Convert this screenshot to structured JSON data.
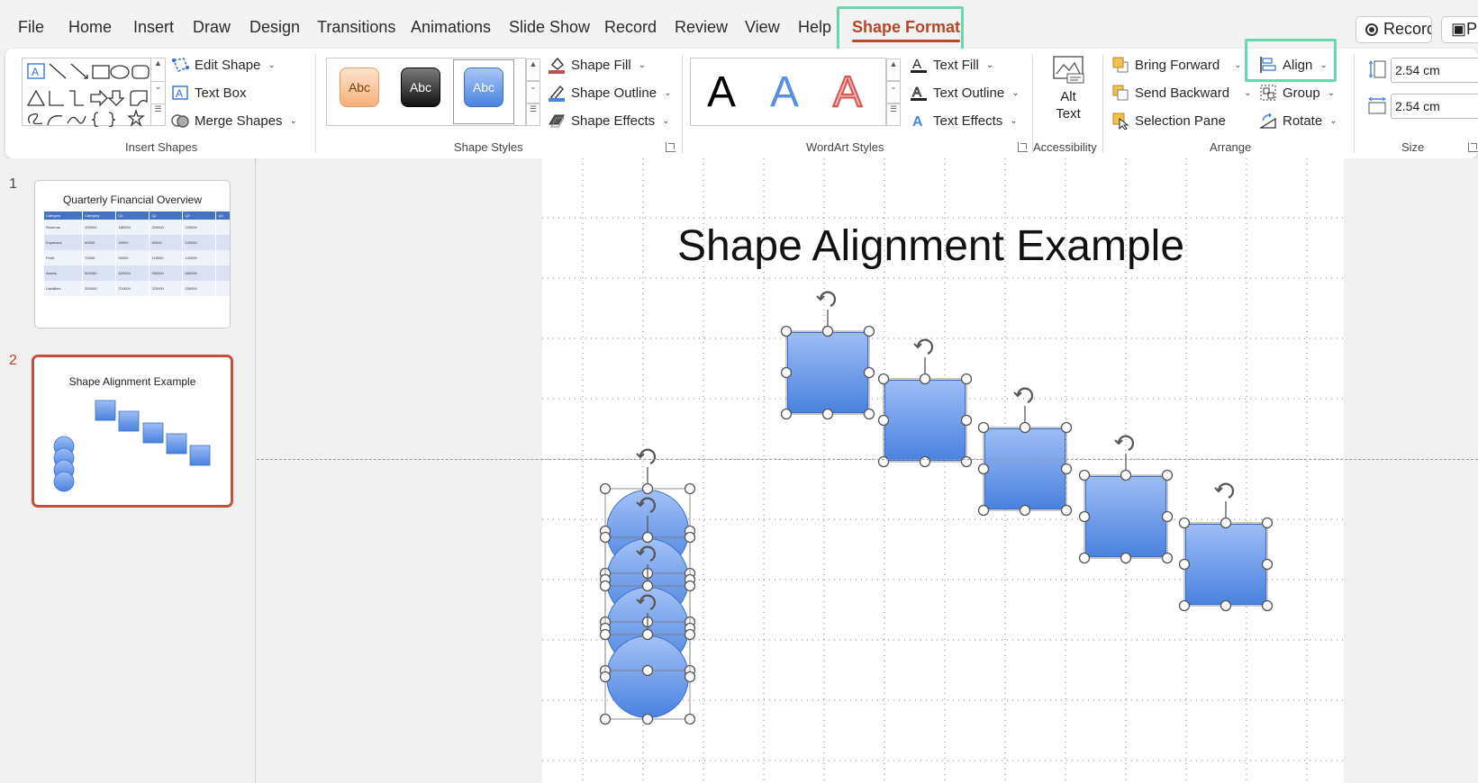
{
  "tabs": [
    "File",
    "Home",
    "Insert",
    "Draw",
    "Design",
    "Transitions",
    "Animations",
    "Slide Show",
    "Record",
    "Review",
    "View",
    "Help",
    "Shape Format"
  ],
  "top_buttons": {
    "record": "Record",
    "present": "Pr"
  },
  "ribbon": {
    "insert_shapes": {
      "label": "Insert Shapes",
      "edit_shape": "Edit Shape",
      "text_box": "Text Box",
      "merge_shapes": "Merge Shapes"
    },
    "shape_styles": {
      "label": "Shape Styles",
      "chips": [
        "Abc",
        "Abc",
        "Abc"
      ],
      "shape_fill": "Shape Fill",
      "shape_outline": "Shape Outline",
      "shape_effects": "Shape Effects"
    },
    "wordart": {
      "label": "WordArt Styles",
      "letters": [
        "A",
        "A",
        "A"
      ],
      "text_fill": "Text Fill",
      "text_outline": "Text Outline",
      "text_effects": "Text Effects"
    },
    "accessibility": {
      "label": "Accessibility",
      "alt_text_line1": "Alt",
      "alt_text_line2": "Text"
    },
    "arrange": {
      "label": "Arrange",
      "bring_forward": "Bring Forward",
      "send_backward": "Send Backward",
      "selection_pane": "Selection Pane",
      "align": "Align",
      "group": "Group",
      "rotate": "Rotate"
    },
    "size": {
      "label": "Size",
      "height": "2.54 cm",
      "width": "2.54 cm"
    }
  },
  "slides": [
    {
      "number": "1",
      "title": "Quarterly Financial Overview",
      "table": {
        "headers": [
          "Category",
          "Category",
          "Q1",
          "Q2",
          "Q3",
          "Q4"
        ],
        "rows": [
          [
            "Revenue",
            "150000",
            "180000",
            "200000",
            "220000"
          ],
          [
            "Expenses",
            "80000",
            "90000",
            "85000",
            "100000"
          ],
          [
            "Profit",
            "70000",
            "90000",
            "115000",
            "120000"
          ],
          [
            "Assets",
            "500000",
            "520000",
            "550000",
            "580000"
          ],
          [
            "Liabilities",
            "200000",
            "210000",
            "220000",
            "230000"
          ]
        ]
      }
    },
    {
      "number": "2",
      "title": "Shape Alignment Example"
    }
  ],
  "canvas": {
    "title": "Shape Alignment Example"
  },
  "colors": {
    "accent": "#b7472a",
    "highlight": "#67d9ad",
    "shape_fill_top": "#9dbcf5",
    "shape_fill_bottom": "#4a82df"
  }
}
